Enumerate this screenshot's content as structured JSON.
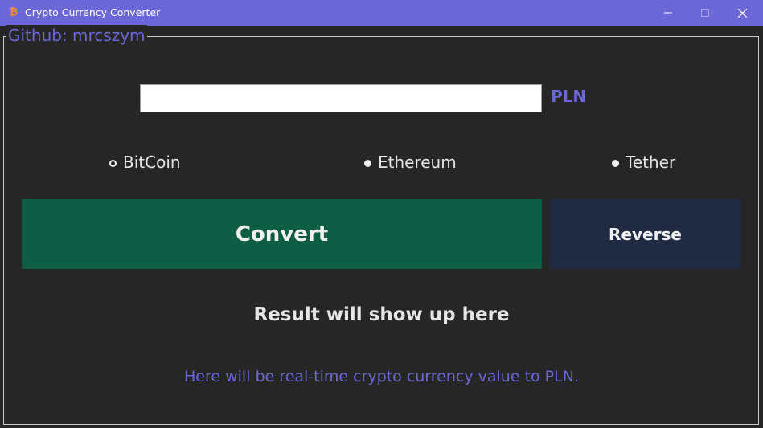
{
  "window": {
    "title": "Crypto Currency Converter",
    "icon": "bitcoin-icon",
    "icon_glyph": "₿",
    "controls": [
      "minimize-icon",
      "maximize-icon",
      "close-icon"
    ]
  },
  "frame": {
    "label": "Github: mrcszym"
  },
  "converter": {
    "input_value": "",
    "currency": "PLN",
    "options": [
      {
        "label": "BitCoin",
        "selected": true
      },
      {
        "label": "Ethereum",
        "selected": false
      },
      {
        "label": "Tether",
        "selected": false
      }
    ],
    "convert_label": "Convert",
    "reverse_label": "Reverse"
  },
  "result_text": "Result will show up here",
  "info_text": "Here will be real-time crypto currency value to PLN.",
  "colors": {
    "titlebar": "#6b67d6",
    "background": "#262626",
    "accent": "#6b67d6",
    "convert_button": "#0e5e45",
    "reverse_button": "#212a43",
    "bitcoin_orange": "#f7931a"
  }
}
